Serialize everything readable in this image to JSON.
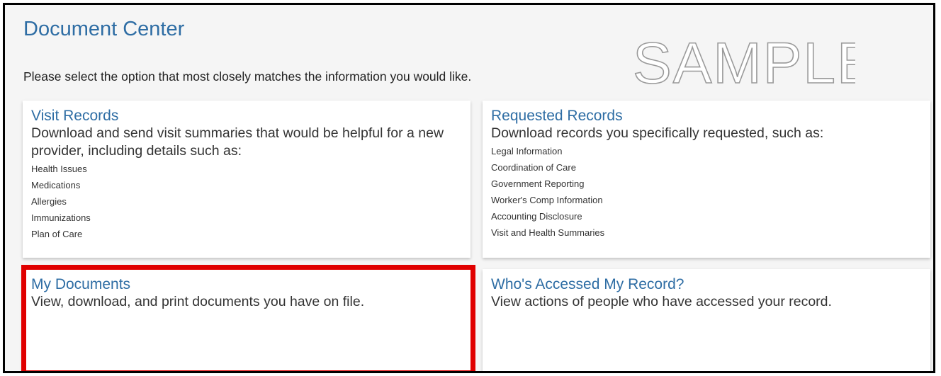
{
  "page": {
    "title": "Document Center",
    "instructions": "Please select the option that most closely matches the information you would like.",
    "watermark": "SAMPLE"
  },
  "cards": {
    "visit_records": {
      "title": "Visit Records",
      "description": "Download and send visit summaries that would be helpful for a new provider, including details such as:",
      "items": [
        "Health Issues",
        "Medications",
        "Allergies",
        "Immunizations",
        "Plan of Care"
      ]
    },
    "requested_records": {
      "title": "Requested Records",
      "description": "Download records you specifically requested, such as:",
      "items": [
        "Legal Information",
        "Coordination of Care",
        "Government Reporting",
        "Worker's Comp Information",
        "Accounting Disclosure",
        "Visit and Health Summaries"
      ]
    },
    "my_documents": {
      "title": "My Documents",
      "description": "View, download, and print documents you have on file."
    },
    "whos_accessed": {
      "title": "Who's Accessed My Record?",
      "description": "View actions of people who have accessed your record."
    }
  },
  "colors": {
    "link_blue": "#2e6da4",
    "highlight_red": "#e00000",
    "background": "#f5f5f5"
  }
}
